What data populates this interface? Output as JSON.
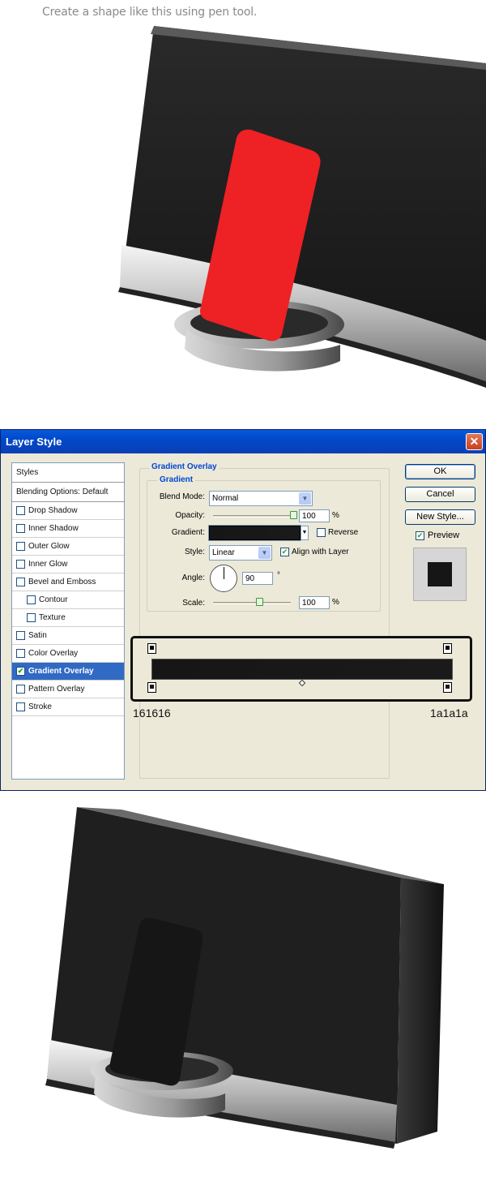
{
  "caption": "Create a shape like this using pen tool.",
  "dialog": {
    "title": "Layer Style",
    "close_glyph": "✕",
    "styles_list": [
      {
        "label": "Styles",
        "checkbox": false,
        "indent": false,
        "active": false,
        "head": true
      },
      {
        "label": "Blending Options: Default",
        "checkbox": false,
        "indent": false,
        "active": false,
        "head": true
      },
      {
        "label": "Drop Shadow",
        "checkbox": true,
        "checked": false,
        "indent": false,
        "active": false
      },
      {
        "label": "Inner Shadow",
        "checkbox": true,
        "checked": false,
        "indent": false,
        "active": false
      },
      {
        "label": "Outer Glow",
        "checkbox": true,
        "checked": false,
        "indent": false,
        "active": false
      },
      {
        "label": "Inner Glow",
        "checkbox": true,
        "checked": false,
        "indent": false,
        "active": false
      },
      {
        "label": "Bevel and Emboss",
        "checkbox": true,
        "checked": false,
        "indent": false,
        "active": false
      },
      {
        "label": "Contour",
        "checkbox": true,
        "checked": false,
        "indent": true,
        "active": false
      },
      {
        "label": "Texture",
        "checkbox": true,
        "checked": false,
        "indent": true,
        "active": false
      },
      {
        "label": "Satin",
        "checkbox": true,
        "checked": false,
        "indent": false,
        "active": false
      },
      {
        "label": "Color Overlay",
        "checkbox": true,
        "checked": false,
        "indent": false,
        "active": false
      },
      {
        "label": "Gradient Overlay",
        "checkbox": true,
        "checked": true,
        "indent": false,
        "active": true
      },
      {
        "label": "Pattern Overlay",
        "checkbox": true,
        "checked": false,
        "indent": false,
        "active": false
      },
      {
        "label": "Stroke",
        "checkbox": true,
        "checked": false,
        "indent": false,
        "active": false
      }
    ],
    "section_title": "Gradient Overlay",
    "group_title": "Gradient",
    "blend_mode": {
      "label": "Blend Mode:",
      "value": "Normal"
    },
    "opacity": {
      "label": "Opacity:",
      "value": "100",
      "unit": "%",
      "level": 1.0
    },
    "gradient": {
      "label": "Gradient:",
      "reverse_label": "Reverse",
      "reverse_checked": false
    },
    "style": {
      "label": "Style:",
      "value": "Linear",
      "align_label": "Align with Layer",
      "align_checked": true
    },
    "angle": {
      "label": "Angle:",
      "value": "90",
      "unit": "°"
    },
    "scale": {
      "label": "Scale:",
      "value": "100",
      "unit": "%",
      "level": 0.6
    },
    "buttons": {
      "ok": "OK",
      "cancel": "Cancel",
      "new_style": "New Style..."
    },
    "preview": {
      "label": "Preview",
      "checked": true
    },
    "gradient_stops": {
      "left_color": "161616",
      "right_color": "1a1a1a"
    }
  },
  "colors": {
    "red_shape": "#ee2124",
    "dark_shape": "#161616",
    "device_body": "#1f1f1f"
  }
}
